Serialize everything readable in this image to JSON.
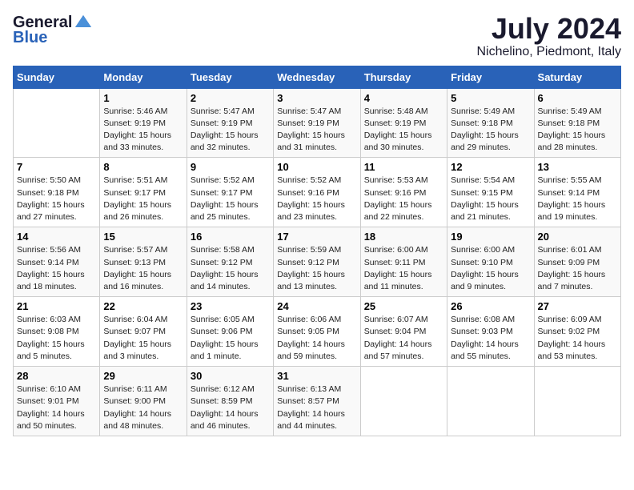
{
  "logo": {
    "general": "General",
    "blue": "Blue"
  },
  "title": "July 2024",
  "location": "Nichelino, Piedmont, Italy",
  "days_of_week": [
    "Sunday",
    "Monday",
    "Tuesday",
    "Wednesday",
    "Thursday",
    "Friday",
    "Saturday"
  ],
  "weeks": [
    [
      {
        "day": "",
        "info": ""
      },
      {
        "day": "1",
        "info": "Sunrise: 5:46 AM\nSunset: 9:19 PM\nDaylight: 15 hours\nand 33 minutes."
      },
      {
        "day": "2",
        "info": "Sunrise: 5:47 AM\nSunset: 9:19 PM\nDaylight: 15 hours\nand 32 minutes."
      },
      {
        "day": "3",
        "info": "Sunrise: 5:47 AM\nSunset: 9:19 PM\nDaylight: 15 hours\nand 31 minutes."
      },
      {
        "day": "4",
        "info": "Sunrise: 5:48 AM\nSunset: 9:19 PM\nDaylight: 15 hours\nand 30 minutes."
      },
      {
        "day": "5",
        "info": "Sunrise: 5:49 AM\nSunset: 9:18 PM\nDaylight: 15 hours\nand 29 minutes."
      },
      {
        "day": "6",
        "info": "Sunrise: 5:49 AM\nSunset: 9:18 PM\nDaylight: 15 hours\nand 28 minutes."
      }
    ],
    [
      {
        "day": "7",
        "info": "Sunrise: 5:50 AM\nSunset: 9:18 PM\nDaylight: 15 hours\nand 27 minutes."
      },
      {
        "day": "8",
        "info": "Sunrise: 5:51 AM\nSunset: 9:17 PM\nDaylight: 15 hours\nand 26 minutes."
      },
      {
        "day": "9",
        "info": "Sunrise: 5:52 AM\nSunset: 9:17 PM\nDaylight: 15 hours\nand 25 minutes."
      },
      {
        "day": "10",
        "info": "Sunrise: 5:52 AM\nSunset: 9:16 PM\nDaylight: 15 hours\nand 23 minutes."
      },
      {
        "day": "11",
        "info": "Sunrise: 5:53 AM\nSunset: 9:16 PM\nDaylight: 15 hours\nand 22 minutes."
      },
      {
        "day": "12",
        "info": "Sunrise: 5:54 AM\nSunset: 9:15 PM\nDaylight: 15 hours\nand 21 minutes."
      },
      {
        "day": "13",
        "info": "Sunrise: 5:55 AM\nSunset: 9:14 PM\nDaylight: 15 hours\nand 19 minutes."
      }
    ],
    [
      {
        "day": "14",
        "info": "Sunrise: 5:56 AM\nSunset: 9:14 PM\nDaylight: 15 hours\nand 18 minutes."
      },
      {
        "day": "15",
        "info": "Sunrise: 5:57 AM\nSunset: 9:13 PM\nDaylight: 15 hours\nand 16 minutes."
      },
      {
        "day": "16",
        "info": "Sunrise: 5:58 AM\nSunset: 9:12 PM\nDaylight: 15 hours\nand 14 minutes."
      },
      {
        "day": "17",
        "info": "Sunrise: 5:59 AM\nSunset: 9:12 PM\nDaylight: 15 hours\nand 13 minutes."
      },
      {
        "day": "18",
        "info": "Sunrise: 6:00 AM\nSunset: 9:11 PM\nDaylight: 15 hours\nand 11 minutes."
      },
      {
        "day": "19",
        "info": "Sunrise: 6:00 AM\nSunset: 9:10 PM\nDaylight: 15 hours\nand 9 minutes."
      },
      {
        "day": "20",
        "info": "Sunrise: 6:01 AM\nSunset: 9:09 PM\nDaylight: 15 hours\nand 7 minutes."
      }
    ],
    [
      {
        "day": "21",
        "info": "Sunrise: 6:03 AM\nSunset: 9:08 PM\nDaylight: 15 hours\nand 5 minutes."
      },
      {
        "day": "22",
        "info": "Sunrise: 6:04 AM\nSunset: 9:07 PM\nDaylight: 15 hours\nand 3 minutes."
      },
      {
        "day": "23",
        "info": "Sunrise: 6:05 AM\nSunset: 9:06 PM\nDaylight: 15 hours\nand 1 minute."
      },
      {
        "day": "24",
        "info": "Sunrise: 6:06 AM\nSunset: 9:05 PM\nDaylight: 14 hours\nand 59 minutes."
      },
      {
        "day": "25",
        "info": "Sunrise: 6:07 AM\nSunset: 9:04 PM\nDaylight: 14 hours\nand 57 minutes."
      },
      {
        "day": "26",
        "info": "Sunrise: 6:08 AM\nSunset: 9:03 PM\nDaylight: 14 hours\nand 55 minutes."
      },
      {
        "day": "27",
        "info": "Sunrise: 6:09 AM\nSunset: 9:02 PM\nDaylight: 14 hours\nand 53 minutes."
      }
    ],
    [
      {
        "day": "28",
        "info": "Sunrise: 6:10 AM\nSunset: 9:01 PM\nDaylight: 14 hours\nand 50 minutes."
      },
      {
        "day": "29",
        "info": "Sunrise: 6:11 AM\nSunset: 9:00 PM\nDaylight: 14 hours\nand 48 minutes."
      },
      {
        "day": "30",
        "info": "Sunrise: 6:12 AM\nSunset: 8:59 PM\nDaylight: 14 hours\nand 46 minutes."
      },
      {
        "day": "31",
        "info": "Sunrise: 6:13 AM\nSunset: 8:57 PM\nDaylight: 14 hours\nand 44 minutes."
      },
      {
        "day": "",
        "info": ""
      },
      {
        "day": "",
        "info": ""
      },
      {
        "day": "",
        "info": ""
      }
    ]
  ]
}
